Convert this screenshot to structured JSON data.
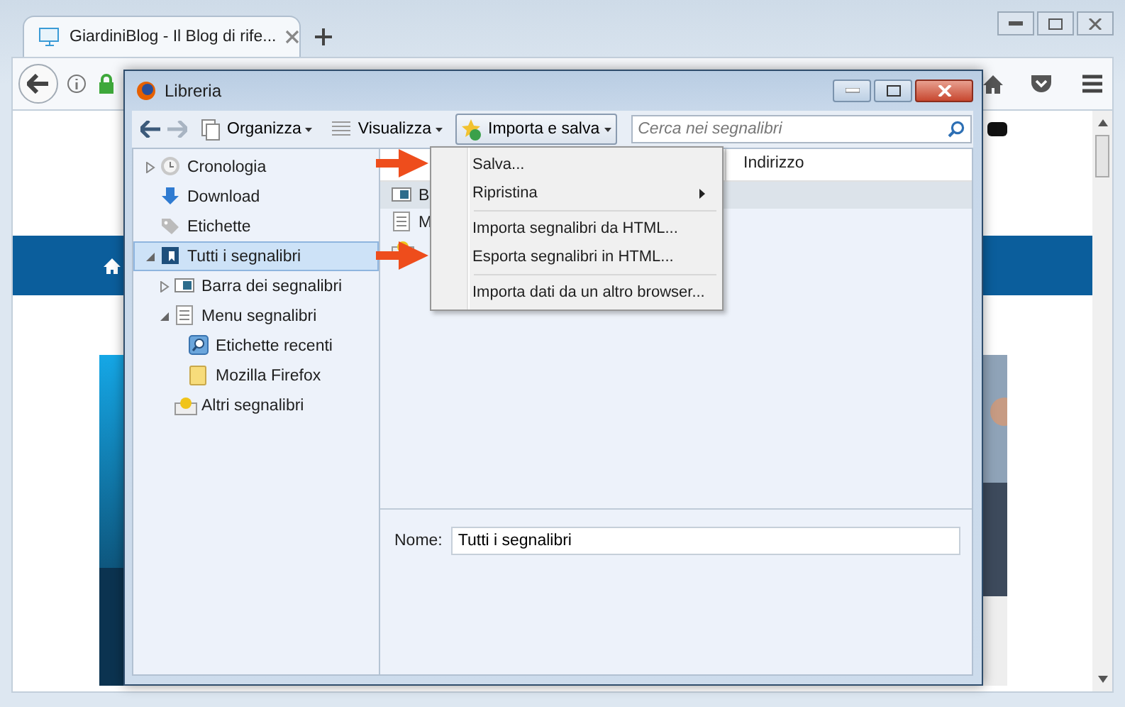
{
  "browser": {
    "tabs": [
      {
        "title": "GiardiniBlog - Il Blog di rife...",
        "selected": true
      }
    ]
  },
  "library": {
    "title": "Libreria",
    "toolbar": [
      {
        "label": "Organizza",
        "kind": "pages",
        "pressed": false
      },
      {
        "label": "Visualizza",
        "kind": "list",
        "pressed": false
      },
      {
        "label": "Importa e salva",
        "kind": "star",
        "pressed": true
      }
    ],
    "search": {
      "placeholder": "Cerca nei segnalibri"
    },
    "sidebar": {
      "items": [
        {
          "label": "Cronologia",
          "kind": "clock",
          "expanded": false,
          "selected": false
        },
        {
          "label": "Download",
          "kind": "download",
          "selected": false
        },
        {
          "label": "Etichette",
          "kind": "tag",
          "selected": false
        },
        {
          "label": "Tutti i segnalibri",
          "kind": "library",
          "expanded": true,
          "selected": true,
          "children": [
            {
              "label": "Barra dei segnalibri",
              "kind": "toolbar",
              "expanded": false,
              "selected": false
            },
            {
              "label": "Menu segnalibri",
              "kind": "menu",
              "expanded": true,
              "selected": false,
              "children": [
                {
                  "label": "Etichette recenti",
                  "kind": "query",
                  "selected": false
                },
                {
                  "label": "Mozilla Firefox",
                  "kind": "folder",
                  "selected": false
                }
              ]
            },
            {
              "label": "Altri segnalibri",
              "kind": "other",
              "selected": false
            }
          ]
        }
      ]
    },
    "list": {
      "column_2": "Indirizzo",
      "rows": [
        {
          "name": "B",
          "kind": "toolbar",
          "selected": true
        },
        {
          "name": "M",
          "kind": "menu",
          "selected": false
        },
        {
          "kind": "other",
          "selected": false
        }
      ]
    },
    "details": {
      "label": "Nome:",
      "value": "Tutti i segnalibri"
    },
    "menu": {
      "items": [
        {
          "kind": "item",
          "label": "Salva...",
          "marked": true
        },
        {
          "kind": "submenu",
          "label": "Ripristina",
          "marked": false
        },
        {
          "kind": "separator"
        },
        {
          "kind": "item",
          "label": "Importa segnalibri da HTML...",
          "marked": false
        },
        {
          "kind": "item",
          "label": "Esporta segnalibri in HTML...",
          "marked": true
        },
        {
          "kind": "separator"
        },
        {
          "kind": "item",
          "label": "Importa dati da un altro browser...",
          "marked": false
        }
      ]
    }
  }
}
